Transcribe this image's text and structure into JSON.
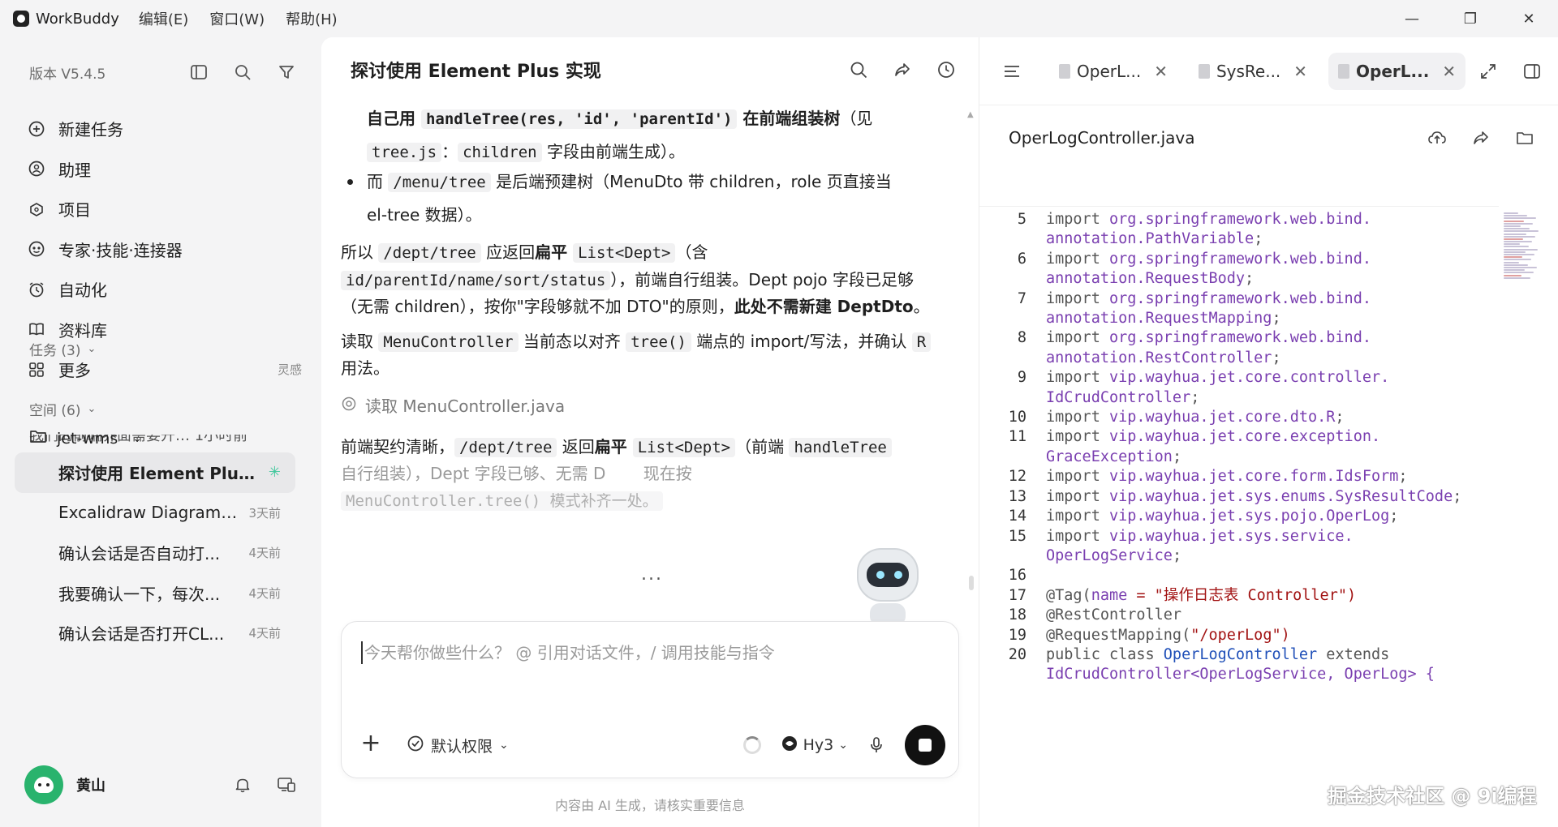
{
  "titlebar": {
    "app_name": "WorkBuddy",
    "menus": [
      "编辑(E)",
      "窗口(W)",
      "帮助(H)"
    ],
    "controls": [
      "—",
      "❐",
      "✕"
    ]
  },
  "sidebar": {
    "version": "版本 V5.4.5",
    "nav": [
      {
        "label": "新建任务",
        "icon": "plus-circle-icon"
      },
      {
        "label": "助理",
        "icon": "assistant-icon"
      },
      {
        "label": "项目",
        "icon": "project-icon"
      },
      {
        "label": "专家·技能·连接器",
        "icon": "experts-icon"
      },
      {
        "label": "自动化",
        "icon": "alarm-clock-icon"
      },
      {
        "label": "资料库",
        "icon": "book-icon"
      },
      {
        "label": "更多",
        "icon": "grid-icon",
        "hint": "灵感"
      }
    ],
    "tasks_header": "任务 (3)",
    "clipped_task": "我们的前端界面需要开…    1小时前",
    "spaces_header": "空间 (6)",
    "project": "jet-wms",
    "sessions": [
      {
        "title": "探讨使用 Element Plus...",
        "time": "",
        "active": true
      },
      {
        "title": "Excalidraw Diagram ...",
        "time": "3天前"
      },
      {
        "title": "确认会话是否自动打...",
        "time": "4天前"
      },
      {
        "title": "我要确认一下，每次...",
        "time": "4天前"
      },
      {
        "title": "确认会话是否打开CL...",
        "time": "4天前"
      }
    ],
    "user_name": "黄山"
  },
  "chat": {
    "title": "探讨使用 Element Plus 实现",
    "cont1_code": "handleTree(res, 'id', 'parentId')",
    "cont1_pre": "自己用 ",
    "cont1_bold": " 在前端组装树",
    "cont1_post": "（见",
    "cont2_code1": "tree.js",
    "cont2_sep": "：",
    "cont2_code2": "children",
    "cont2_post": " 字段由前端生成）。",
    "bullet_pre": "而 ",
    "bullet_code": "/menu/tree",
    "bullet_post": " 是后端预建树（MenuDto 带 children，role 页直接当",
    "bullet_cont": "el-tree 数据）。",
    "p1_a": "所以 ",
    "p1_code1": "/dept/tree",
    "p1_b": " 应返回",
    "p1_bold1": "扁平 ",
    "p1_code2": "List<Dept>",
    "p1_c": "（含",
    "p1_code3": "id/parentId/name/sort/status",
    "p1_d": "），前端自行组装。Dept pojo 字段已足够（无需 children），按你\"字段够就不加 DTO\"的原则，",
    "p1_bold2": "此处不需新建 DeptDto",
    "p1_e": "。",
    "p2_a": "读取 ",
    "p2_code1": "MenuController",
    "p2_b": " 当前态以对齐 ",
    "p2_code2": "tree()",
    "p2_c": " 端点的 import/写法，并确认 ",
    "p2_code3": "R",
    "p2_d": " 用法。",
    "tool_line": "读取 MenuController.java",
    "p3_a": "前端契约清晰，",
    "p3_code1": "/dept/tree",
    "p3_b": " 返回",
    "p3_bold": "扁平 ",
    "p3_code2": "List<Dept>",
    "p3_c": "（前端 ",
    "p3_code3": "handleTree",
    "p3_d": "自行组装），Dept 字段已够、无需 D",
    "p3_e": " 现在按",
    "p3_fade": "MenuController.tree() 模式补齐一处。",
    "typing_dots": "...",
    "input_placeholder": "今天帮你做些什么？ @ 引用对话文件，/ 调用技能与指令",
    "perm_label": "默认权限",
    "model_label": "Hy3",
    "disclaimer": "内容由 AI 生成，请核实重要信息"
  },
  "editor": {
    "tabs": [
      {
        "label": "OperL...",
        "active": false
      },
      {
        "label": "SysRe...",
        "active": false
      },
      {
        "label": "OperL...",
        "active": true
      }
    ],
    "file_name": "OperLogController.java",
    "code": [
      {
        "n": "5",
        "kw": "import ",
        "pkg": "org.springframework.web.bind.",
        "rest": ""
      },
      {
        "n": "",
        "kw": "",
        "pkg": "annotation.PathVariable",
        "rest": ";"
      },
      {
        "n": "6",
        "kw": "import ",
        "pkg": "org.springframework.web.bind.",
        "rest": ""
      },
      {
        "n": "",
        "kw": "",
        "pkg": "annotation.RequestBody",
        "rest": ";"
      },
      {
        "n": "7",
        "kw": "import ",
        "pkg": "org.springframework.web.bind.",
        "rest": ""
      },
      {
        "n": "",
        "kw": "",
        "pkg": "annotation.RequestMapping",
        "rest": ";"
      },
      {
        "n": "8",
        "kw": "import ",
        "pkg": "org.springframework.web.bind.",
        "rest": ""
      },
      {
        "n": "",
        "kw": "",
        "pkg": "annotation.RestController",
        "rest": ";"
      },
      {
        "n": "9",
        "kw": "import ",
        "pkg": "vip.wayhua.jet.core.controller.",
        "rest": ""
      },
      {
        "n": "",
        "kw": "",
        "pkg": "IdCrudController",
        "rest": ";"
      },
      {
        "n": "10",
        "kw": "import ",
        "pkg": "vip.wayhua.jet.core.dto.R",
        "rest": ";"
      },
      {
        "n": "11",
        "kw": "import ",
        "pkg": "vip.wayhua.jet.core.exception.",
        "rest": ""
      },
      {
        "n": "",
        "kw": "",
        "pkg": "GraceException",
        "rest": ";"
      },
      {
        "n": "12",
        "kw": "import ",
        "pkg": "vip.wayhua.jet.core.form.IdsForm",
        "rest": ";"
      },
      {
        "n": "13",
        "kw": "import ",
        "pkg": "vip.wayhua.jet.sys.enums.SysResultCode",
        "rest": ";"
      },
      {
        "n": "14",
        "kw": "import ",
        "pkg": "vip.wayhua.jet.sys.pojo.OperLog",
        "rest": ";"
      },
      {
        "n": "15",
        "kw": "import ",
        "pkg": "vip.wayhua.jet.sys.service.",
        "rest": ""
      },
      {
        "n": "",
        "kw": "",
        "pkg": "OperLogService",
        "rest": ";"
      },
      {
        "n": "16",
        "kw": "",
        "pkg": "",
        "rest": ""
      },
      {
        "n": "17",
        "kw": "@Tag(",
        "pkg": "name",
        "rest": " = \"操作日志表 Controller\")"
      },
      {
        "n": "18",
        "kw": "@RestController",
        "pkg": "",
        "rest": ""
      },
      {
        "n": "19",
        "kw": "@RequestMapping(",
        "pkg": "",
        "rest": "\"/operLog\")"
      },
      {
        "n": "20",
        "kw": "public class ",
        "pkg": "OperLogController",
        "rest": " extends"
      },
      {
        "n": "",
        "kw": "",
        "pkg": "IdCrudController<OperLogService, OperLog> {",
        "rest": ""
      }
    ]
  },
  "watermark": "掘金技术社区 @ 9i编程"
}
